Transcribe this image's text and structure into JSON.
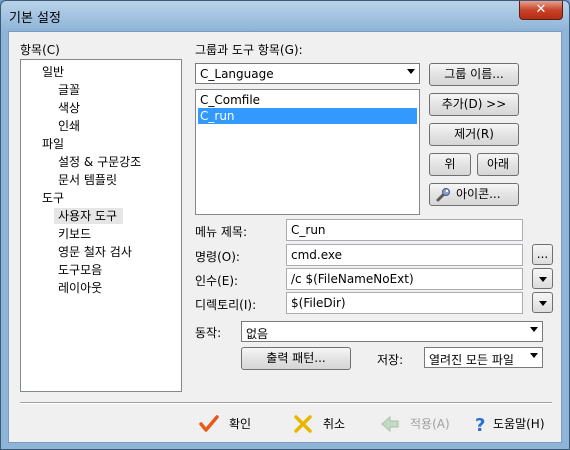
{
  "window": {
    "title": "기본 설정",
    "close_label": "✕"
  },
  "tree": {
    "label": "항목(C)",
    "items": [
      {
        "label": "일반",
        "level": 1
      },
      {
        "label": "글꼴",
        "level": 2
      },
      {
        "label": "색상",
        "level": 2
      },
      {
        "label": "인쇄",
        "level": 2
      },
      {
        "label": "파일",
        "level": 1
      },
      {
        "label": "설정 & 구문강조",
        "level": 2
      },
      {
        "label": "문서 템플릿",
        "level": 2
      },
      {
        "label": "도구",
        "level": 1
      },
      {
        "label": "사용자 도구",
        "level": 2
      },
      {
        "label": "키보드",
        "level": 2
      },
      {
        "label": "영문 철자 검사",
        "level": 2
      },
      {
        "label": "도구모음",
        "level": 2
      },
      {
        "label": "레이아웃",
        "level": 2
      }
    ],
    "selected": "사용자 도구"
  },
  "group": {
    "label": "그룹과 도구 항목(G):",
    "combo_value": "C_Language",
    "list_items": [
      "C_Comfile",
      "C_run"
    ],
    "selected_item": "C_run"
  },
  "buttons": {
    "group_name": "그룹 이름...",
    "add": "추가(D) >>",
    "remove": "제거(R)",
    "up": "위",
    "down": "아래",
    "icon": "아이콘...",
    "output_pattern": "출력 패턴...",
    "browse": "..."
  },
  "fields": {
    "menu_title_label": "메뉴 제목:",
    "menu_title_value": "C_run",
    "command_label": "명령(O):",
    "command_value": "cmd.exe",
    "args_label": "인수(E):",
    "args_value": "/c $(FileNameNoExt)",
    "dir_label": "디렉토리(I):",
    "dir_value": "$(FileDir)",
    "action_label": "동작:",
    "action_value": "없음",
    "save_label": "저장:",
    "save_value": "열려진 모든 파일"
  },
  "footer": {
    "ok": "확인",
    "cancel": "취소",
    "apply": "적용(A)",
    "help": "도움말(H)"
  },
  "colors": {
    "selection": "#3399ff",
    "ok_icon": "#e8591a",
    "cancel_icon": "#e8b800",
    "help_icon": "#2a6fd6"
  }
}
